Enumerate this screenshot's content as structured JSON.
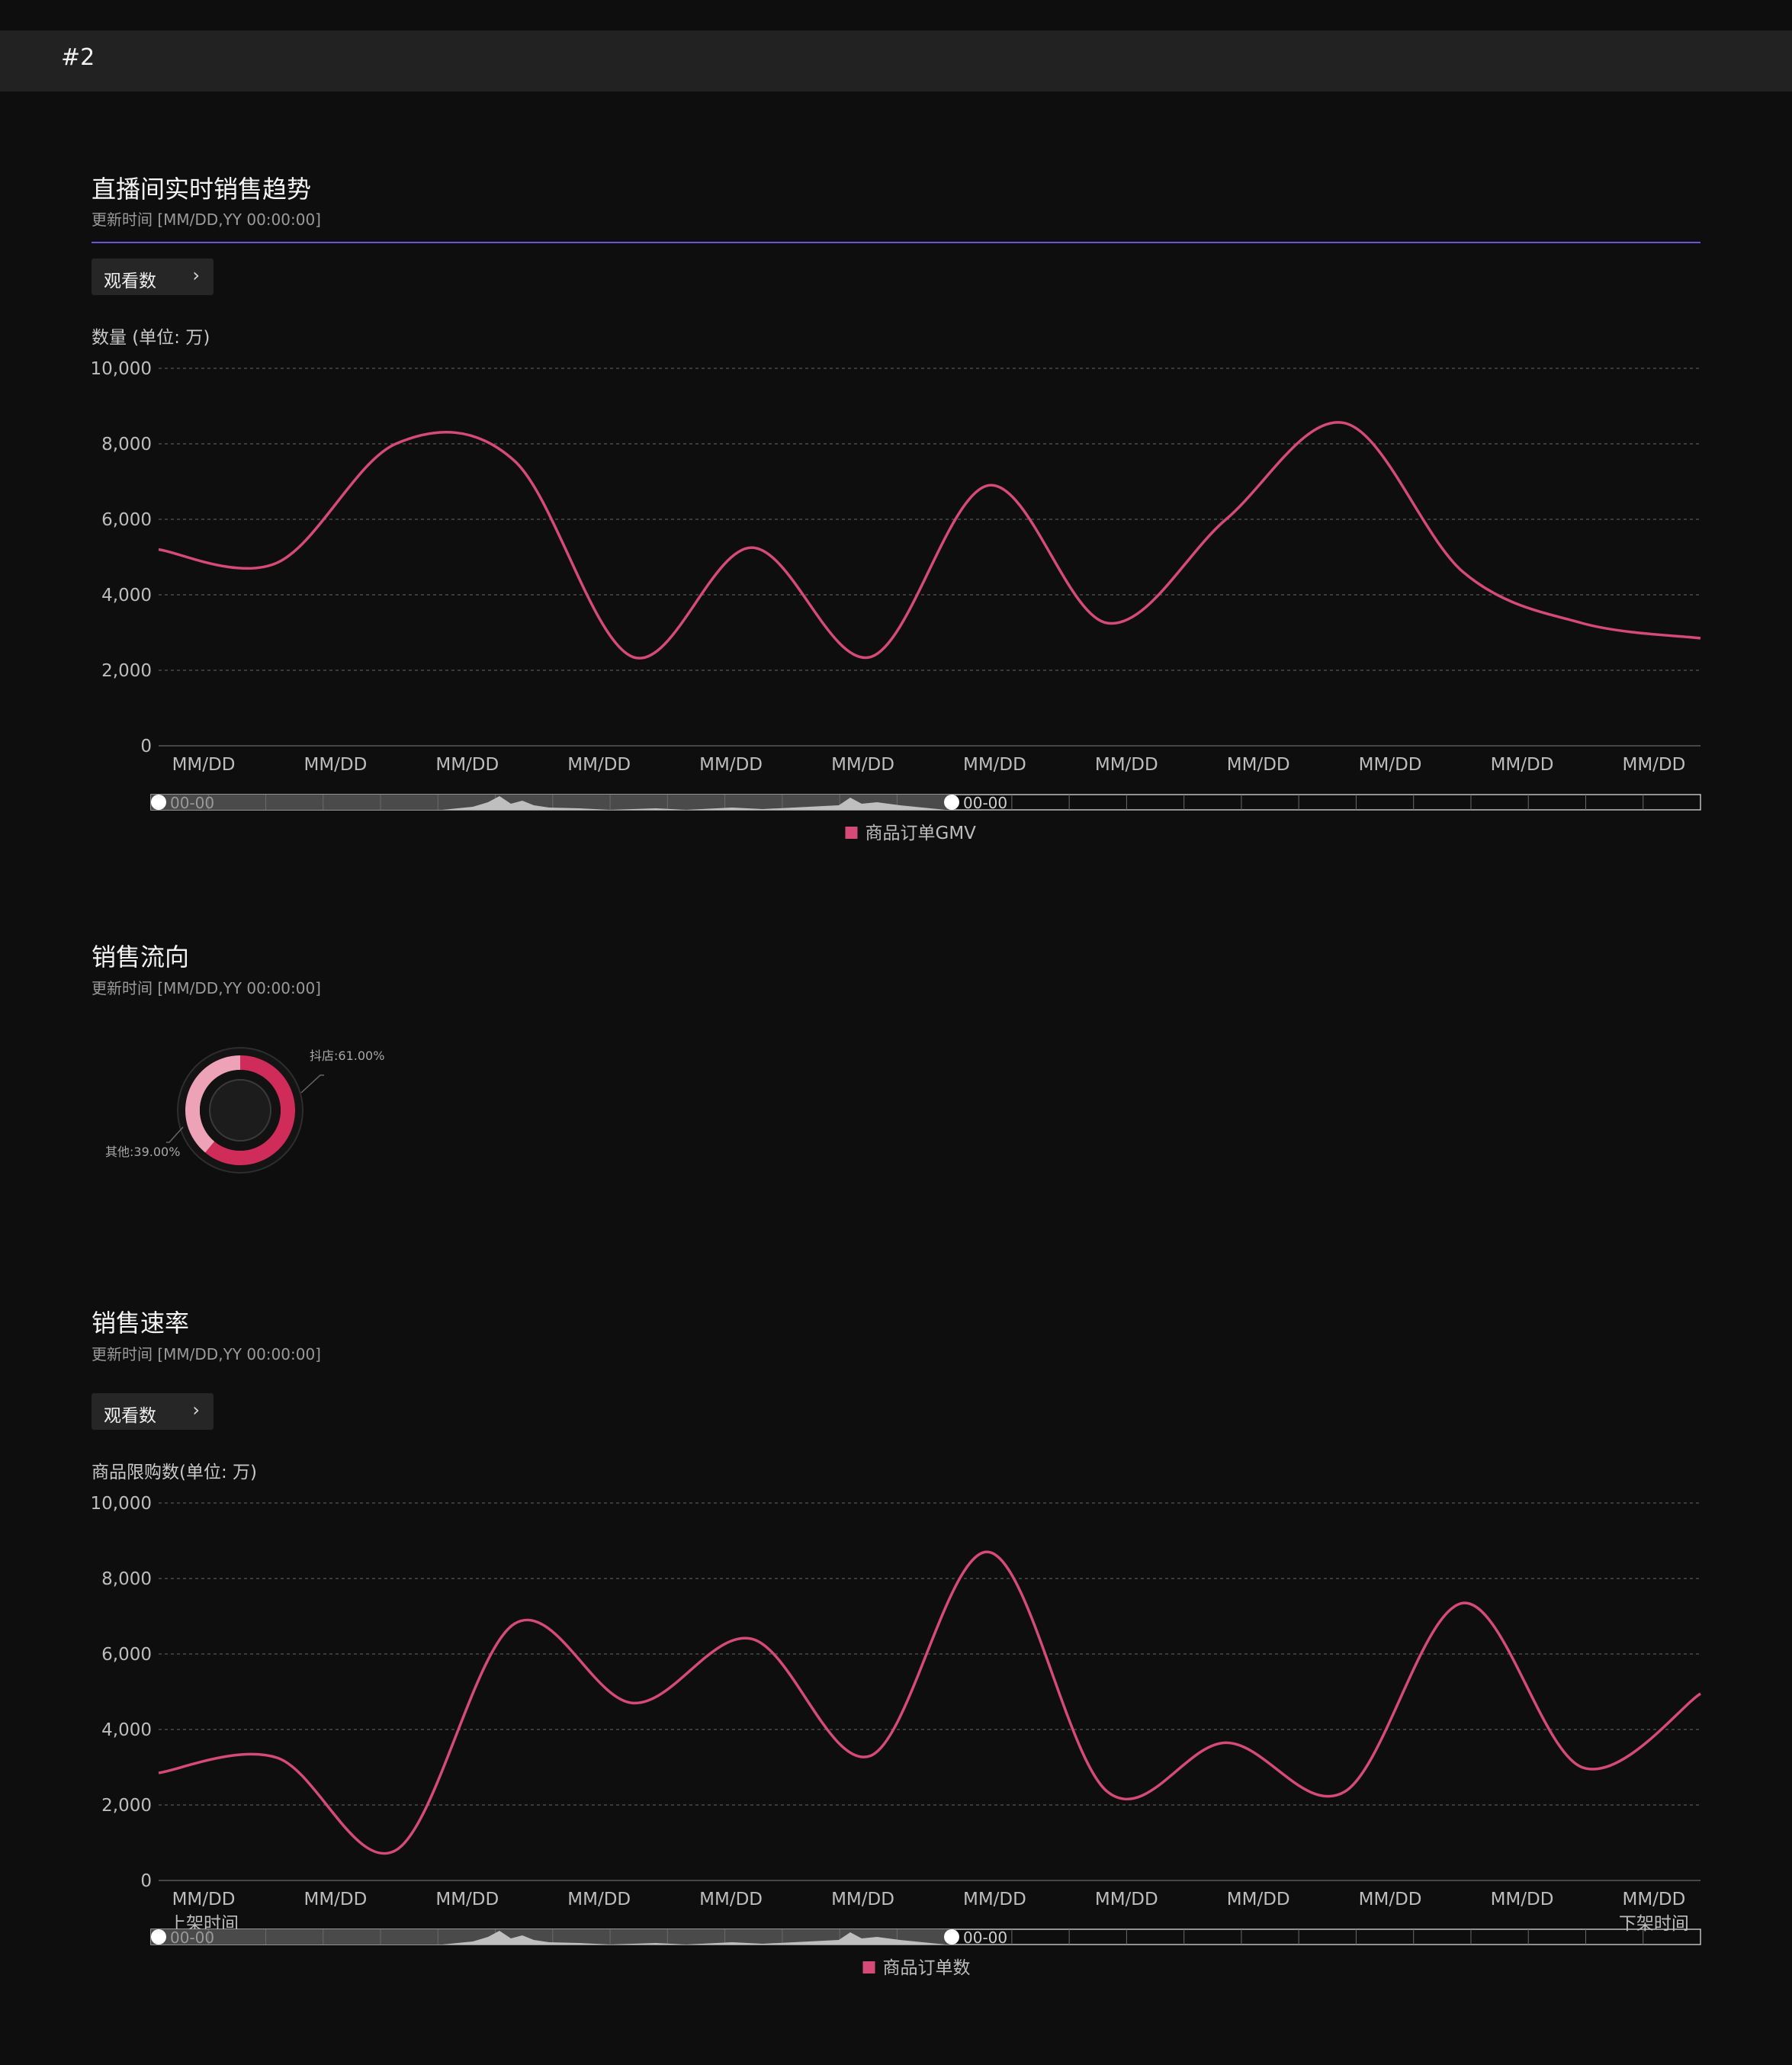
{
  "header": {
    "tag": "#2"
  },
  "trend": {
    "title": "直播间实时销售趋势",
    "updated": "更新时间 [MM/DD,YY 00:00:00]",
    "selector_label": "观看数",
    "slider_start_label": "00-00",
    "slider_end_label": "00-00"
  },
  "flow": {
    "title": "销售流向",
    "updated": "更新时间 [MM/DD,YY 00:00:00]"
  },
  "rate": {
    "title": "销售速率",
    "updated": "更新时间 [MM/DD,YY 00:00:00]",
    "selector_label": "观看数",
    "slider_start_label": "00-00",
    "slider_end_label": "00-00"
  },
  "colors": {
    "line": "#d64a77",
    "accent": "#6a55d8",
    "donut_main": "#cf2c5a",
    "donut_other": "#eda2b7"
  },
  "chart_data": [
    {
      "type": "line",
      "title": "",
      "ylabel": "数量 (单位: 万)",
      "xlabel": "",
      "ylim": [
        0,
        10000
      ],
      "yticks": [
        "10,000",
        "8,000",
        "6,000",
        "4,000",
        "2,000",
        "0"
      ],
      "grid": true,
      "legend_position": "bottom-center",
      "categories": [
        "MM/DD",
        "MM/DD",
        "MM/DD",
        "MM/DD",
        "MM/DD",
        "MM/DD",
        "MM/DD",
        "MM/DD",
        "MM/DD",
        "MM/DD",
        "MM/DD",
        "MM/DD"
      ],
      "x_edge_labels": [
        "",
        ""
      ],
      "series": [
        {
          "name": "商品订单GMV",
          "values": [
            5200,
            4850,
            8000,
            7550,
            2350,
            5250,
            2350,
            6900,
            3250,
            6000,
            8550,
            4600,
            3250,
            2850
          ]
        }
      ]
    },
    {
      "type": "pie",
      "title": "",
      "slices": [
        {
          "label": "抖店:61.00%",
          "value": 61.0
        },
        {
          "label": "其他:39.00%",
          "value": 39.0
        }
      ]
    },
    {
      "type": "line",
      "title": "",
      "ylabel": "商品限购数(单位: 万)",
      "xlabel": "",
      "ylim": [
        0,
        10000
      ],
      "yticks": [
        "10,000",
        "8,000",
        "6,000",
        "4,000",
        "2,000",
        "0"
      ],
      "grid": true,
      "legend_position": "bottom-center",
      "categories": [
        "MM/DD",
        "MM/DD",
        "MM/DD",
        "MM/DD",
        "MM/DD",
        "MM/DD",
        "MM/DD",
        "MM/DD",
        "MM/DD",
        "MM/DD",
        "MM/DD",
        "MM/DD"
      ],
      "x_edge_labels": [
        "上架时间",
        "下架时间"
      ],
      "series": [
        {
          "name": "商品订单数",
          "values": [
            2850,
            3250,
            800,
            6800,
            4700,
            6400,
            3300,
            8700,
            2350,
            3650,
            2350,
            7350,
            3000,
            4950
          ]
        }
      ]
    }
  ]
}
